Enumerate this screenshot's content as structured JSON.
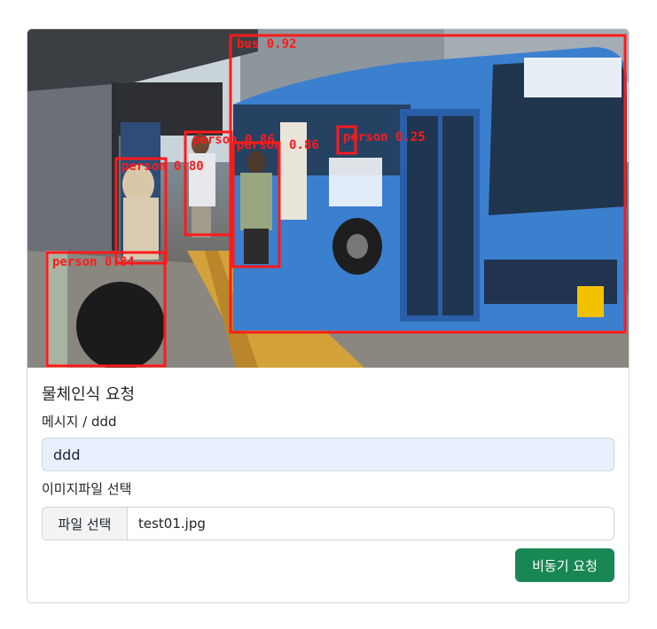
{
  "detection": {
    "labels": [
      "bus 0.92",
      "person 0.86",
      "person 0.80",
      "person 0.84",
      "person 0.25",
      "person 0.86"
    ],
    "box_color": "#ff1a1a"
  },
  "form": {
    "title": "물체인식 요청",
    "message_label": "메시지 / ddd",
    "message_value": "ddd",
    "file_label": "이미지파일 선택",
    "file_button": "파일 선택",
    "file_name": "test01.jpg",
    "submit_label": "비동기 요청",
    "submit_color": "#198754"
  }
}
